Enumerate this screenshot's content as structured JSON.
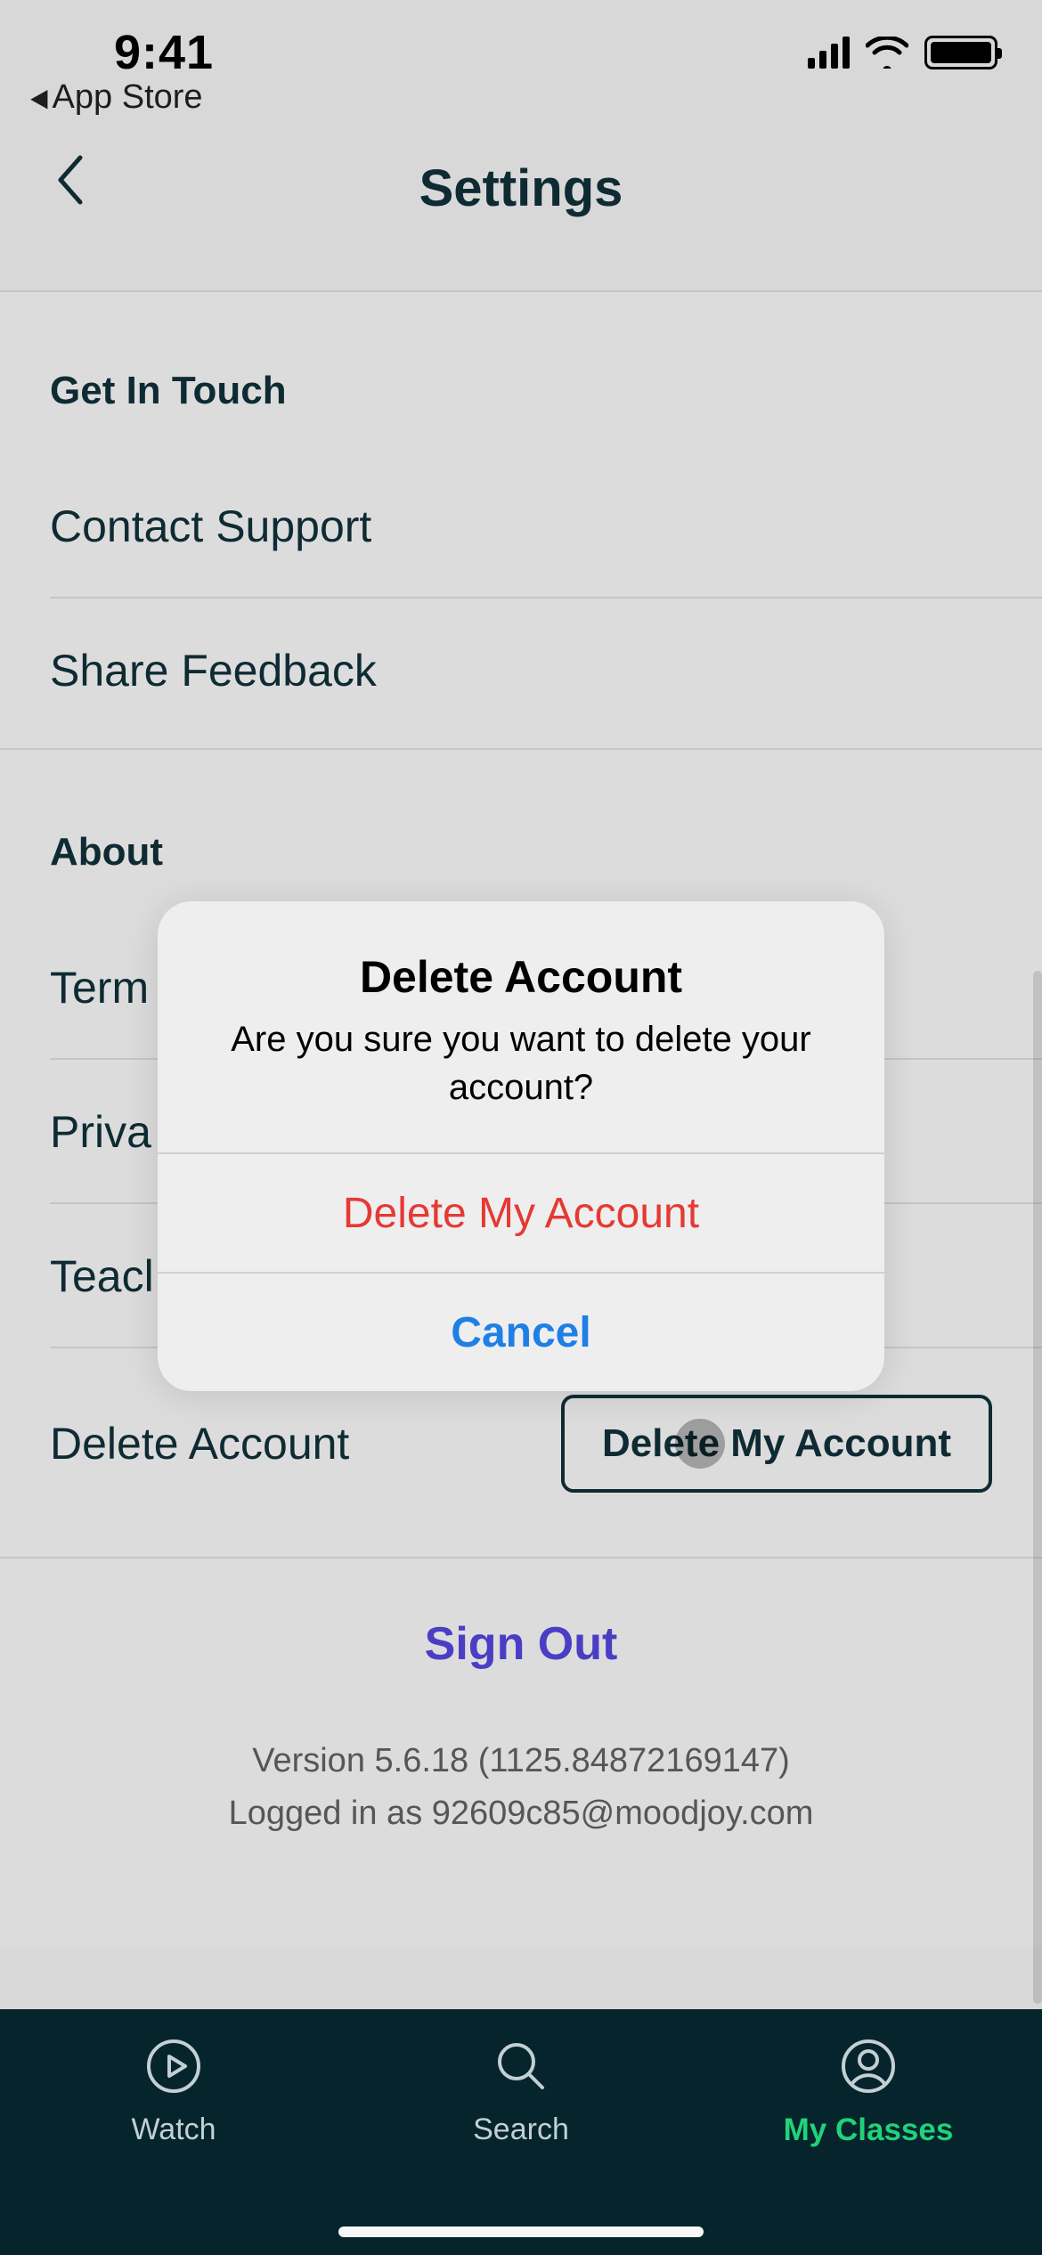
{
  "status": {
    "time": "9:41",
    "back_label": "App Store"
  },
  "header": {
    "title": "Settings"
  },
  "sections": {
    "contact": {
      "title": "Get In Touch",
      "items": [
        "Contact Support",
        "Share Feedback"
      ]
    },
    "about": {
      "title": "About",
      "items": [
        "Term",
        "Priva",
        "Teacl"
      ],
      "delete_label": "Delete Account",
      "delete_button": "Delete My Account"
    }
  },
  "signout": {
    "label": "Sign Out",
    "version_line": "Version 5.6.18 (1125.84872169147)",
    "login_line": "Logged in as 92609c85@moodjoy.com"
  },
  "tabs": {
    "watch": "Watch",
    "search": "Search",
    "myclasses": "My Classes"
  },
  "alert": {
    "title": "Delete Account",
    "message": "Are you sure you want to delete your account?",
    "destructive": "Delete My Account",
    "cancel": "Cancel"
  }
}
